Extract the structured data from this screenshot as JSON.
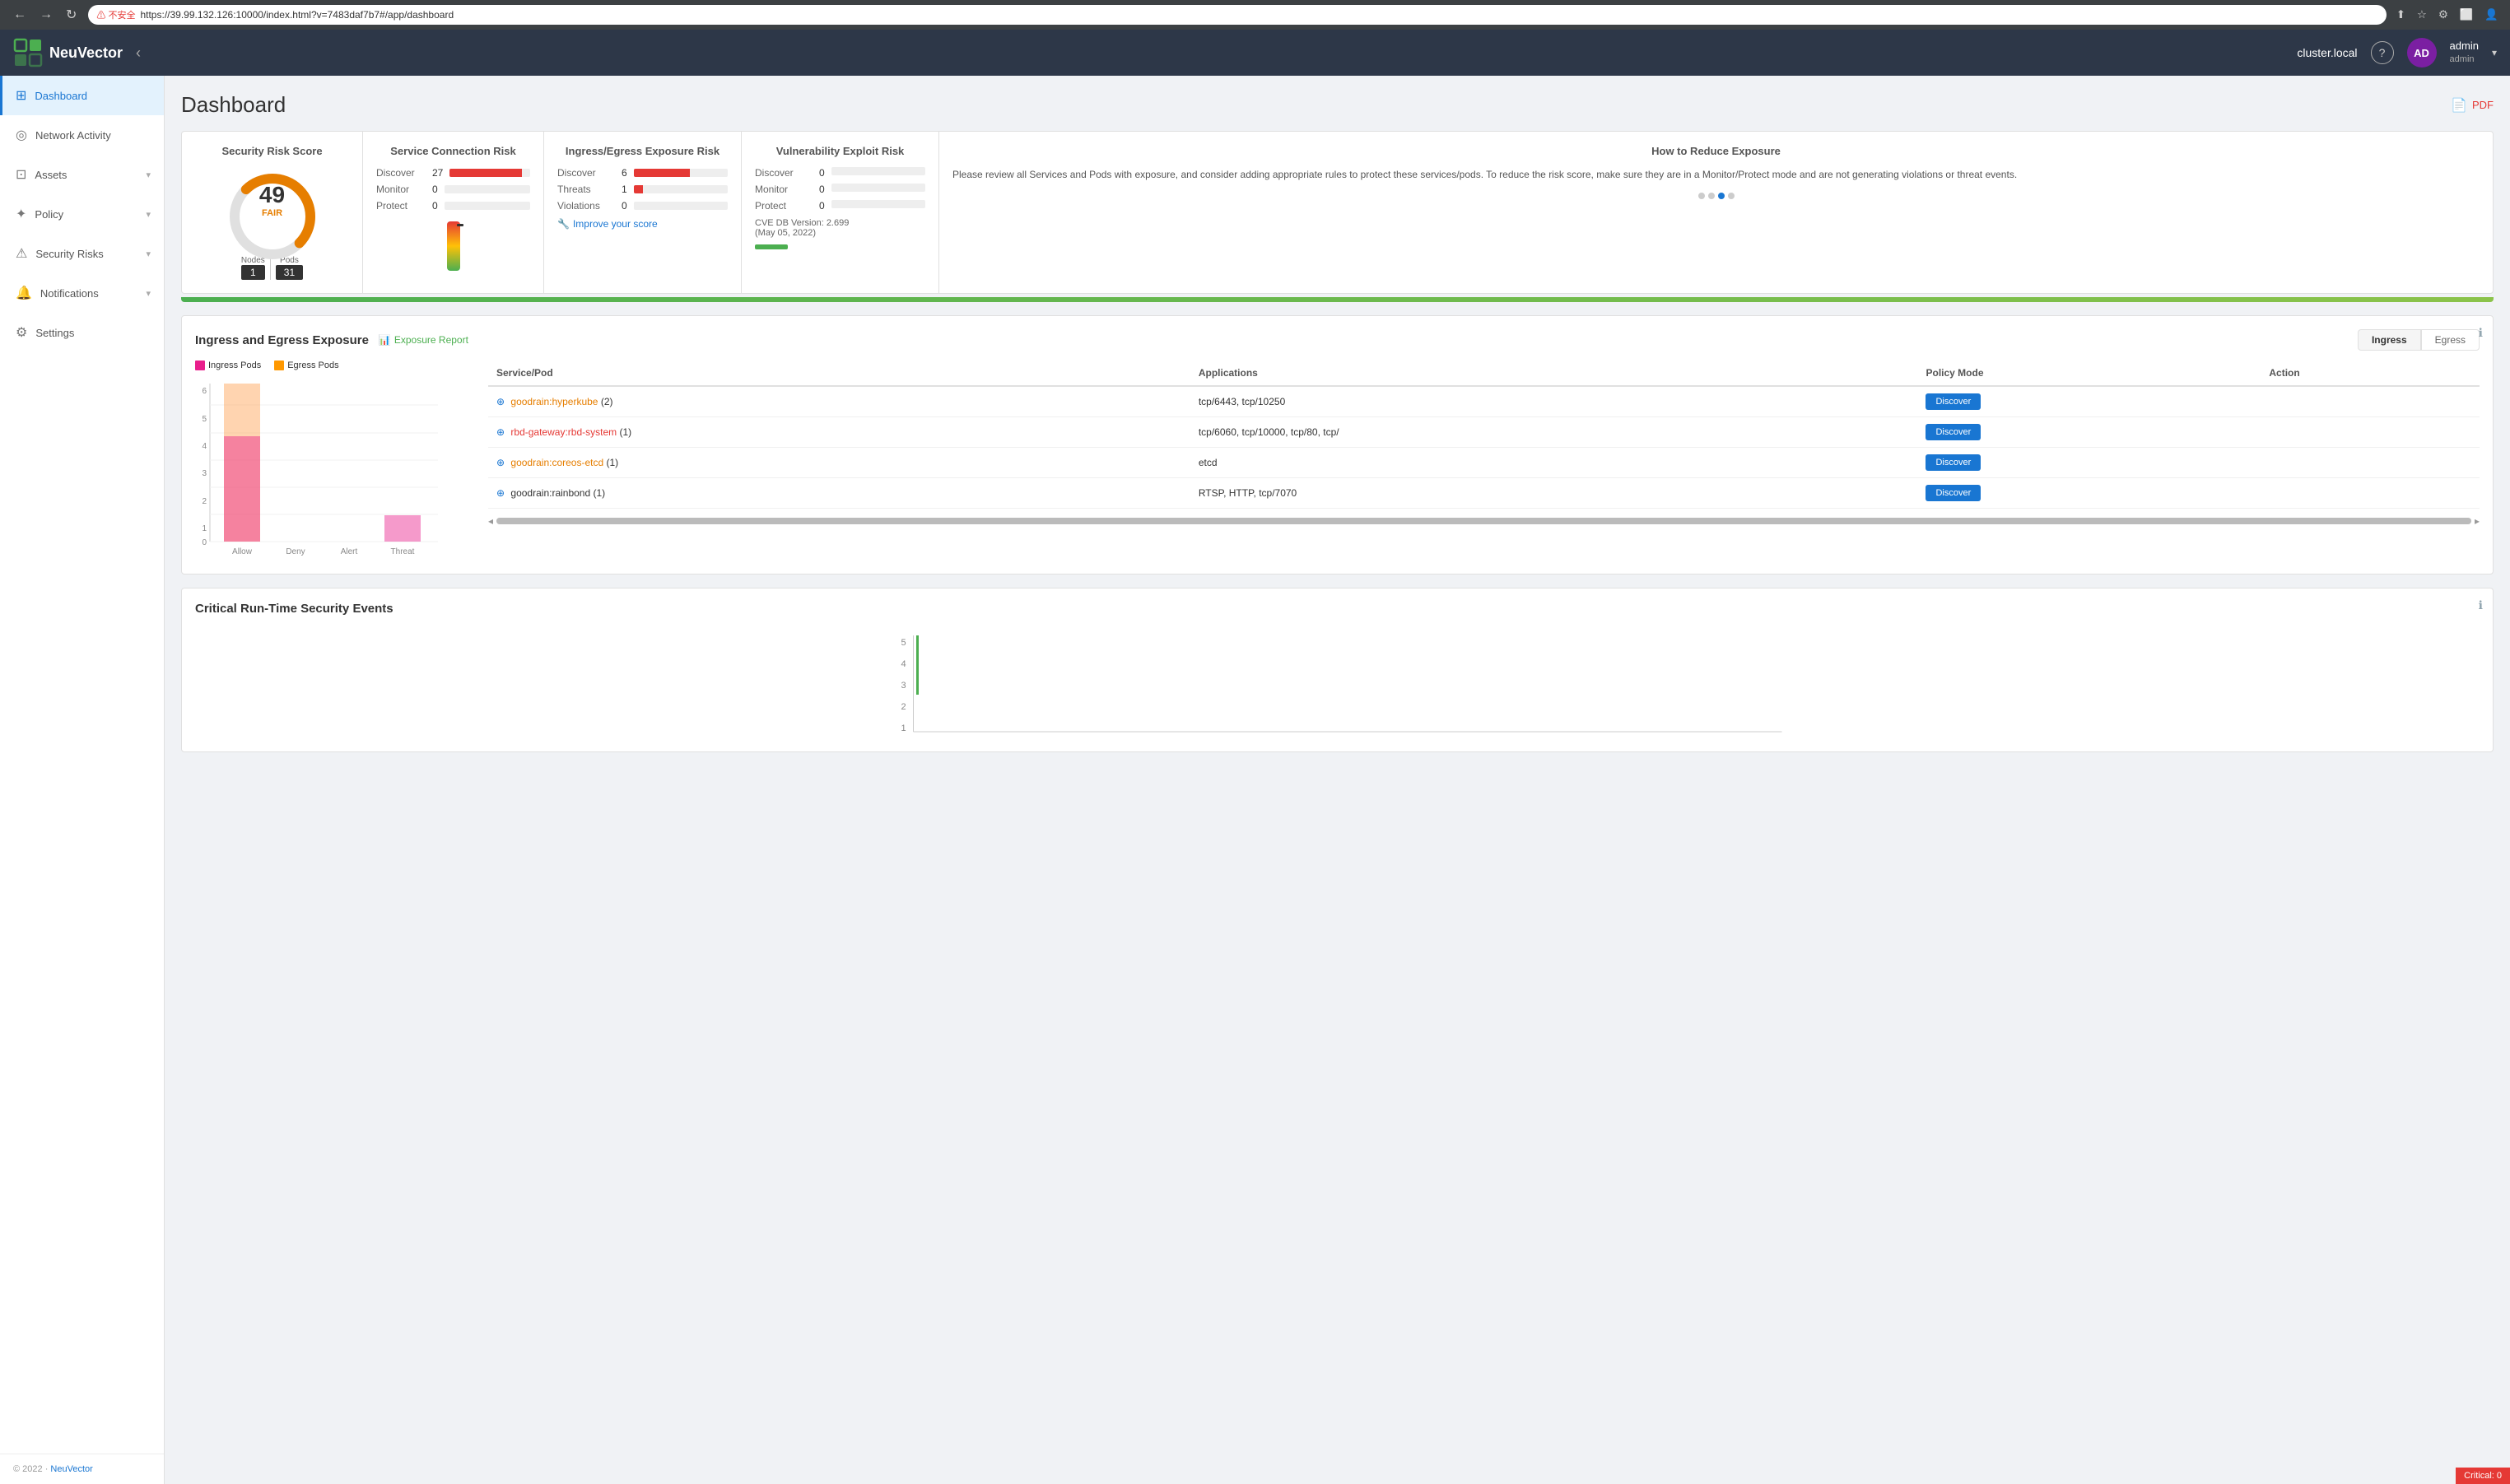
{
  "browser": {
    "url": "https://39.99.132.126:10000/index.html?v=7483daf7b7#/app/dashboard",
    "warning": "不安全",
    "back_label": "←",
    "forward_label": "→",
    "reload_label": "↻"
  },
  "app": {
    "title": "NeuVector",
    "cluster": "cluster.local",
    "user": {
      "initials": "AD",
      "name": "admin",
      "role": "admin"
    },
    "help_label": "?"
  },
  "sidebar": {
    "items": [
      {
        "id": "dashboard",
        "label": "Dashboard",
        "icon": "⊞",
        "active": true,
        "has_children": false
      },
      {
        "id": "network-activity",
        "label": "Network Activity",
        "icon": "◎",
        "active": false,
        "has_children": false
      },
      {
        "id": "assets",
        "label": "Assets",
        "icon": "⊡",
        "active": false,
        "has_children": true
      },
      {
        "id": "policy",
        "label": "Policy",
        "icon": "✦",
        "active": false,
        "has_children": true
      },
      {
        "id": "security-risks",
        "label": "Security Risks",
        "icon": "⚠",
        "active": false,
        "has_children": true
      },
      {
        "id": "notifications",
        "label": "Notifications",
        "icon": "🔔",
        "active": false,
        "has_children": true
      },
      {
        "id": "settings",
        "label": "Settings",
        "icon": "⚙",
        "active": false,
        "has_children": false
      }
    ],
    "footer": {
      "copyright": "© 2022 · ",
      "link_text": "NeuVector"
    }
  },
  "page": {
    "title": "Dashboard",
    "pdf_label": "PDF"
  },
  "security_risk_score": {
    "title": "Security Risk Score",
    "score": "49",
    "rating": "FAIR",
    "nodes_label": "Nodes",
    "pods_label": "Pods",
    "nodes_value": "1",
    "pods_value": "31"
  },
  "service_connection_risk": {
    "title": "Service Connection Risk",
    "rows": [
      {
        "label": "Discover",
        "value": "27"
      },
      {
        "label": "Monitor",
        "value": "0"
      },
      {
        "label": "Protect",
        "value": "0"
      }
    ]
  },
  "ingress_egress_risk": {
    "title": "Ingress/Egress Exposure Risk",
    "rows": [
      {
        "label": "Discover",
        "value": "6"
      },
      {
        "label": "Threats",
        "value": "1"
      },
      {
        "label": "Violations",
        "value": "0"
      }
    ],
    "improve_label": "Improve your score"
  },
  "vulnerability_risk": {
    "title": "Vulnerability Exploit Risk",
    "rows": [
      {
        "label": "Discover",
        "value": "0"
      },
      {
        "label": "Monitor",
        "value": "0"
      },
      {
        "label": "Protect",
        "value": "0"
      }
    ],
    "cve_label": "CVE DB Version: 2.699",
    "cve_date": "(May 05, 2022)"
  },
  "reduce_exposure": {
    "title": "How to Reduce Exposure",
    "text": "Please review all Services and Pods with exposure, and consider adding appropriate rules to protect these services/pods. To reduce the risk score, make sure they are in a Monitor/Protect mode and are not generating violations or threat events."
  },
  "ingress_egress_section": {
    "title": "Ingress and Egress Exposure",
    "report_link": "Exposure Report",
    "toggle_ingress": "Ingress",
    "toggle_egress": "Egress",
    "legend": [
      {
        "label": "Ingress Pods",
        "color": "#e91e8c"
      },
      {
        "label": "Egress Pods",
        "color": "#ff9800"
      }
    ],
    "y_labels": [
      "6",
      "5",
      "4",
      "3",
      "2",
      "1",
      "0"
    ],
    "x_labels": [
      "Allow",
      "Deny",
      "Alert",
      "Threat"
    ],
    "bars": [
      {
        "label": "Allow",
        "ingress": 4,
        "egress": 6,
        "max": 6
      },
      {
        "label": "Deny",
        "ingress": 0,
        "egress": 0,
        "max": 6
      },
      {
        "label": "Alert",
        "ingress": 0,
        "egress": 0,
        "max": 6
      },
      {
        "label": "Threat",
        "ingress": 1,
        "egress": 0,
        "max": 6
      }
    ],
    "table": {
      "columns": [
        "Service/Pod",
        "Applications",
        "Policy Mode",
        "Action"
      ],
      "rows": [
        {
          "service": "goodrain:hyperkube",
          "count": "(2)",
          "applications": "tcp/6443, tcp/10250",
          "mode": "Discover",
          "color": "orange"
        },
        {
          "service": "rbd-gateway:rbd-system",
          "count": "(1)",
          "applications": "tcp/6060, tcp/10000, tcp/80, tcp/",
          "mode": "Discover",
          "color": "red"
        },
        {
          "service": "goodrain:coreos-etcd",
          "count": "(1)",
          "applications": "etcd",
          "mode": "Discover",
          "color": "orange"
        },
        {
          "service": "goodrain:rainbond",
          "count": "(1)",
          "applications": "RTSP, HTTP, tcp/7070",
          "mode": "Discover",
          "color": "black"
        }
      ]
    }
  },
  "critical_events": {
    "title": "Critical Run-Time Security Events",
    "y_labels": [
      "5",
      "4",
      "3",
      "2",
      "1"
    ],
    "critical_badge": "Critical: 0"
  }
}
